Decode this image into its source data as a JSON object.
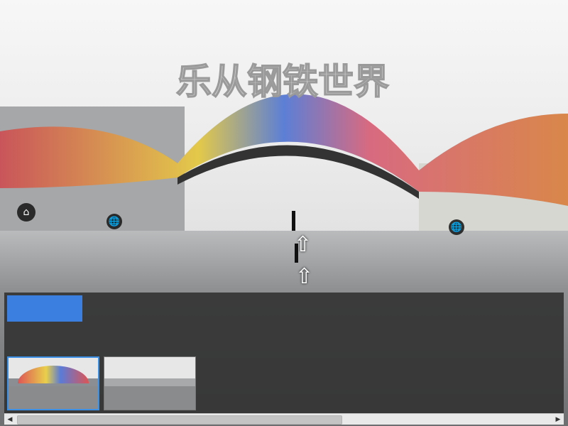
{
  "panorama": {
    "scene_name": "乐从钢铁世界"
  },
  "hotspots": {
    "home_icon": "⌂",
    "globe_icon": "🌐"
  },
  "navigation": {
    "arrow_icon": "⇧"
  },
  "thumbnail_panel": {
    "selected_index": 0,
    "thumbnails_count_visible": 2
  },
  "scrollbar": {
    "left_arrow": "◀",
    "right_arrow": "▶"
  },
  "colors": {
    "accent": "#3b7fe0",
    "panel_bg": "#323232"
  }
}
